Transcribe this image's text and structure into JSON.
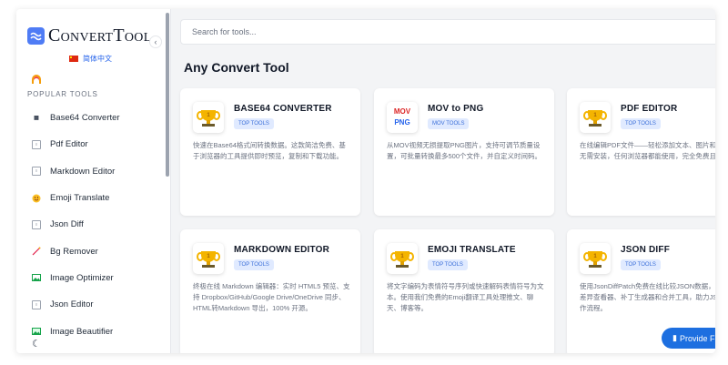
{
  "app": {
    "logo_text": "ConvertTool",
    "language": "简体中文"
  },
  "sidebar": {
    "section_title": "POPULAR TOOLS",
    "items": [
      {
        "label": "Base64 Converter",
        "icon": "b64-icon"
      },
      {
        "label": "Pdf Editor",
        "icon": "file-icon"
      },
      {
        "label": "Markdown Editor",
        "icon": "file-icon"
      },
      {
        "label": "Emoji Translate",
        "icon": "emoji-icon"
      },
      {
        "label": "Json Diff",
        "icon": "file-icon"
      },
      {
        "label": "Bg Remover",
        "icon": "wand-icon"
      },
      {
        "label": "Image Optimizer",
        "icon": "image-icon"
      },
      {
        "label": "Json Editor",
        "icon": "file-icon"
      },
      {
        "label": "Image Beautifier",
        "icon": "image-icon"
      }
    ]
  },
  "search": {
    "placeholder": "Search for tools..."
  },
  "main": {
    "heading": "Any Convert Tool",
    "cards": [
      {
        "title": "BASE64 CONVERTER",
        "tag": "TOP TOOLS",
        "icon": "trophy-icon",
        "desc": "快速在Base64格式间转换数据。这款简洁免费、基于浏览器的工具提供即时预览，复制和下载功能。"
      },
      {
        "title": "MOV to PNG",
        "tag": "MOV TOOLS",
        "icon": "mov-png-icon",
        "icon_text_top": "MOV",
        "icon_text_bottom": "PNG",
        "desc": "从MOV视频无损提取PNG图片，支持可调节质量设置，可批量转换最多500个文件，并自定义时间码。"
      },
      {
        "title": "PDF EDITOR",
        "tag": "TOP TOOLS",
        "icon": "trophy-icon",
        "desc": "在线编辑PDF文件——轻松添加文本、图片和签名。无需安装，任何浏览器都能使用，完全免费且安全。"
      },
      {
        "title": "MARKDOWN EDITOR",
        "tag": "TOP TOOLS",
        "icon": "trophy-icon",
        "desc": "终极在线 Markdown 编辑器：实时 HTML5 预览、支持 Dropbox/GitHub/Google Drive/OneDrive 同步、HTML转Markdown 导出，100% 开源。"
      },
      {
        "title": "EMOJI TRANSLATE",
        "tag": "TOP TOOLS",
        "icon": "trophy-icon",
        "desc": "将文字编码为表情符号序列或快速解码表情符号为文本。使用我们免费的Emoji翻译工具处理推文、聊天、博客等。"
      },
      {
        "title": "JSON DIFF",
        "tag": "TOP TOOLS",
        "icon": "trophy-icon",
        "desc": "使用JsonDiffPatch免费在线比较JSON数据，可视化差异查看器、补丁生成器和合并工具，助力JSON工作流程。"
      }
    ]
  },
  "provide_button": {
    "label": "Provide F"
  },
  "colors": {
    "accent": "#1d6fe0",
    "tag_bg": "#e0eaff",
    "tag_text": "#3b6fd9"
  }
}
